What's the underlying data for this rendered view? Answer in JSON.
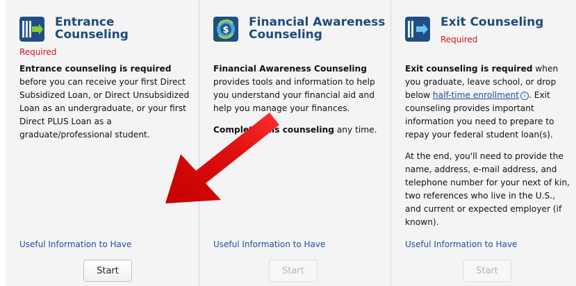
{
  "cards": [
    {
      "title_line1": "Entrance",
      "title_line2": "Counseling",
      "required": "Required",
      "body_bold": "Entrance counseling is required",
      "body_rest": " before you can receive your first Direct Subsidized Loan, or Direct Unsubsidized Loan as an undergraduate, or your first Direct PLUS Loan as a graduate/professional student.",
      "useful_link": "Useful Information to Have",
      "start_label": "Start"
    },
    {
      "title_line1": "Financial Awareness",
      "title_line2": "Counseling",
      "body_bold": "Financial Awareness Counseling",
      "body_rest": " provides tools and information to help you understand your financial aid and help you manage your finances.",
      "body2_pre": "Complete ",
      "body2_bold": "this counseling",
      "body2_rest": " any time.",
      "useful_link": "Useful Information to Have",
      "start_label": "Start"
    },
    {
      "title_line1": "Exit Counseling",
      "required": "Required",
      "body_bold": "Exit counseling is required",
      "body_mid": " when you graduate, leave school, or drop below ",
      "body_link": "half-time enrollment",
      "info_symbol": "i",
      "body_end": ". Exit counseling provides important information you need to prepare to repay your federal student loan(s).",
      "body2": "At the end, you'll need to provide the name, address, e-mail address, and telephone number for your next of kin, two references who live in the U.S., and current or expected employer (if known).",
      "useful_link": "Useful Information to Have",
      "start_label": "Start"
    }
  ],
  "colors": {
    "title": "#1e4b7a",
    "required": "#d0121b",
    "link": "#1f4fa1",
    "arrow": "#e01010"
  },
  "icons": [
    "entrance-door-icon",
    "dollar-coin-icon",
    "exit-door-icon",
    "red-arrow-annotation"
  ]
}
